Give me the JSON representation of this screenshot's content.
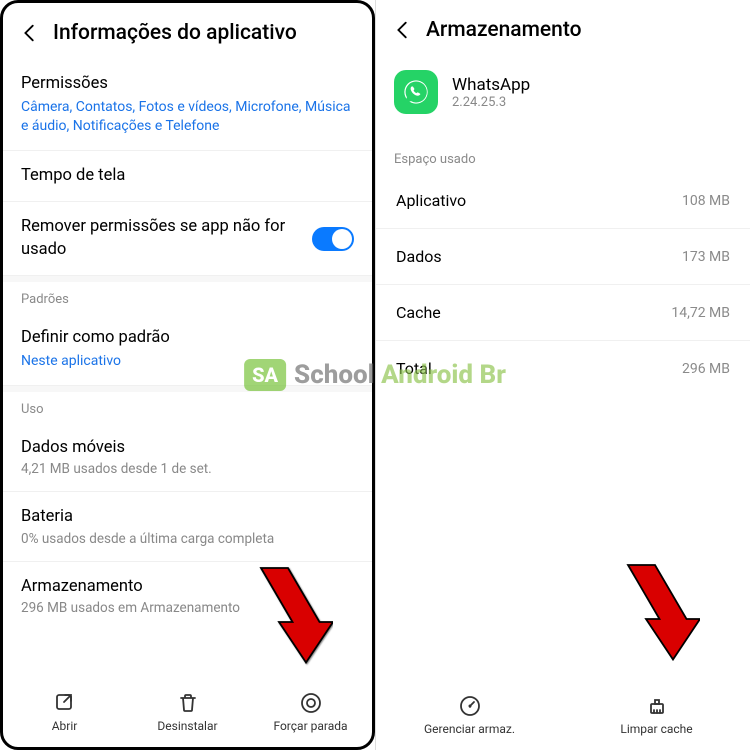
{
  "left": {
    "title": "Informações do aplicativo",
    "permissions": {
      "title": "Permissões",
      "list": "Câmera, Contatos, Fotos e vídeos, Microfone, Música e áudio, Notificações e Telefone"
    },
    "screen_time": {
      "title": "Tempo de tela"
    },
    "remove_perm": {
      "title": "Remover permissões se app não for usado"
    },
    "defaults_label": "Padrões",
    "set_default": {
      "title": "Definir como padrão",
      "sub": "Neste aplicativo"
    },
    "usage_label": "Uso",
    "mobile_data": {
      "title": "Dados móveis",
      "sub": "4,21 MB usados desde 1 de set."
    },
    "battery": {
      "title": "Bateria",
      "sub": "0% usados desde a última carga completa"
    },
    "storage": {
      "title": "Armazenamento",
      "sub": "296 MB usados em Armazenamento"
    },
    "bottom": {
      "open": "Abrir",
      "uninstall": "Desinstalar",
      "force_stop": "Forçar parada"
    }
  },
  "right": {
    "title": "Armazenamento",
    "app": {
      "name": "WhatsApp",
      "version": "2.24.25.3"
    },
    "space_used_label": "Espaço usado",
    "rows": {
      "app": {
        "label": "Aplicativo",
        "value": "108 MB"
      },
      "data": {
        "label": "Dados",
        "value": "173 MB"
      },
      "cache": {
        "label": "Cache",
        "value": "14,72 MB"
      },
      "total": {
        "label": "Total",
        "value": "296 MB"
      }
    },
    "bottom": {
      "manage": "Gerenciar armaz.",
      "clear_cache": "Limpar cache"
    }
  },
  "watermark": {
    "badge": "SA",
    "t1": "School",
    "t2": " Android Br"
  }
}
